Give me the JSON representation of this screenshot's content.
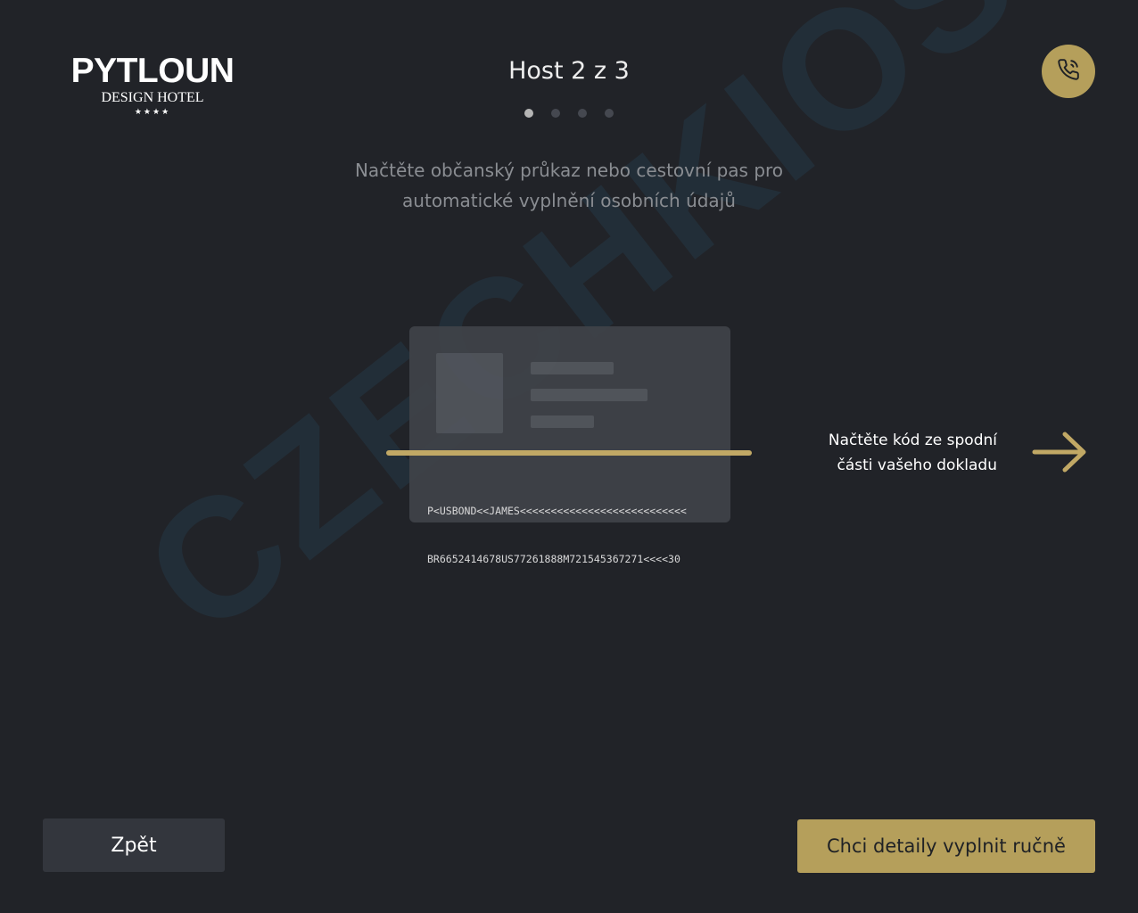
{
  "brand": {
    "name": "PYTLOUN",
    "subtitle": "DESIGN HOTEL",
    "stars": "★★★★"
  },
  "watermark": "CZECHKIOSK",
  "step": {
    "title": "Host 2 z 3",
    "dots_total": 4,
    "dots_active": 1
  },
  "instruction": {
    "line1": "Načtěte občanský průkaz nebo cestovní pas pro",
    "line2": "automatické vyplnění osobních údajů"
  },
  "document": {
    "mrz_line1": "P<USBOND<<JAMES<<<<<<<<<<<<<<<<<<<<<<<<<<<",
    "mrz_line2": "BR6652414678US77261888M721545367271<<<<30"
  },
  "hint": {
    "line1": "Načtěte kód ze spodní",
    "line2": "části vašeho dokladu"
  },
  "buttons": {
    "back_label": "Zpět",
    "manual_label": "Chci detaily vyplnit ručně"
  },
  "icons": {
    "call": "phone-call-icon",
    "arrow": "arrow-right-icon"
  },
  "colors": {
    "background": "#212328",
    "accent": "#b59f5b",
    "scan_line": "#c1a865"
  }
}
